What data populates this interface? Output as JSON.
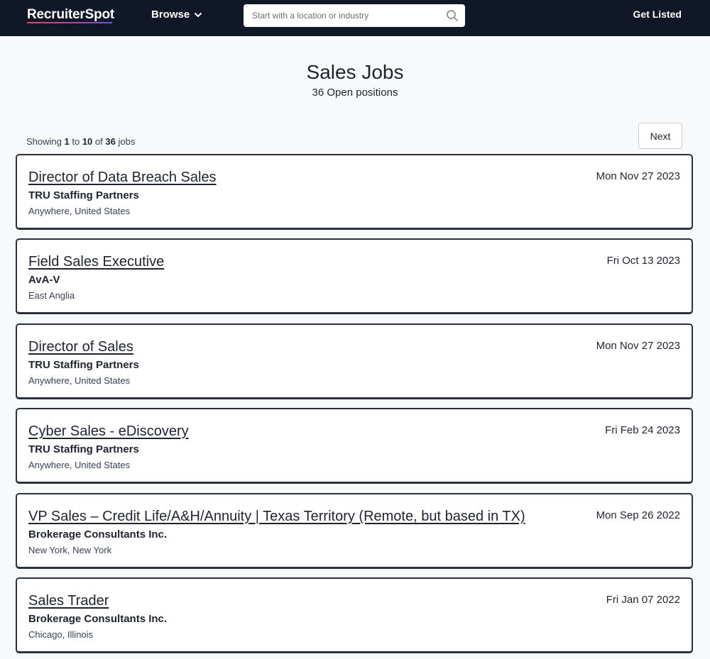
{
  "header": {
    "logo": "RecruiterSpot",
    "browse_label": "Browse",
    "search_placeholder": "Start with a location or industry",
    "search_value": "",
    "get_listed_label": "Get Listed"
  },
  "page": {
    "title": "Sales Jobs",
    "subtitle": "36 Open positions"
  },
  "pagination": {
    "showing_prefix": "Showing",
    "from": "1",
    "to_word": "to",
    "to": "10",
    "of_word": "of",
    "total": "36",
    "suffix": "jobs",
    "next_label": "Next"
  },
  "jobs": [
    {
      "title": "Director of Data Breach Sales",
      "company": "TRU Staffing Partners",
      "location": "Anywhere, United States",
      "date": "Mon Nov 27 2023"
    },
    {
      "title": "Field Sales Executive",
      "company": "AvA-V",
      "location": "East Anglia",
      "date": "Fri Oct 13 2023"
    },
    {
      "title": "Director of Sales",
      "company": "TRU Staffing Partners",
      "location": "Anywhere, United States",
      "date": "Mon Nov 27 2023"
    },
    {
      "title": "Cyber Sales - eDiscovery",
      "company": "TRU Staffing Partners",
      "location": "Anywhere, United States",
      "date": "Fri Feb 24 2023"
    },
    {
      "title": "VP Sales – Credit Life/A&H/Annuity | Texas Territory (Remote, but based in TX)",
      "company": "Brokerage Consultants Inc.",
      "location": "New York, New York",
      "date": "Mon Sep 26 2022"
    },
    {
      "title": "Sales Trader",
      "company": "Brokerage Consultants Inc.",
      "location": "Chicago, Illinois",
      "date": "Fri Jan 07 2022"
    }
  ],
  "icons": {
    "browse": "chevron-down-icon",
    "search": "search-icon"
  },
  "colors": {
    "header_bg": "#101828",
    "page_bg": "#f8f9fa",
    "card_border": "#2a3040",
    "logo_underline": "#e2486e"
  }
}
